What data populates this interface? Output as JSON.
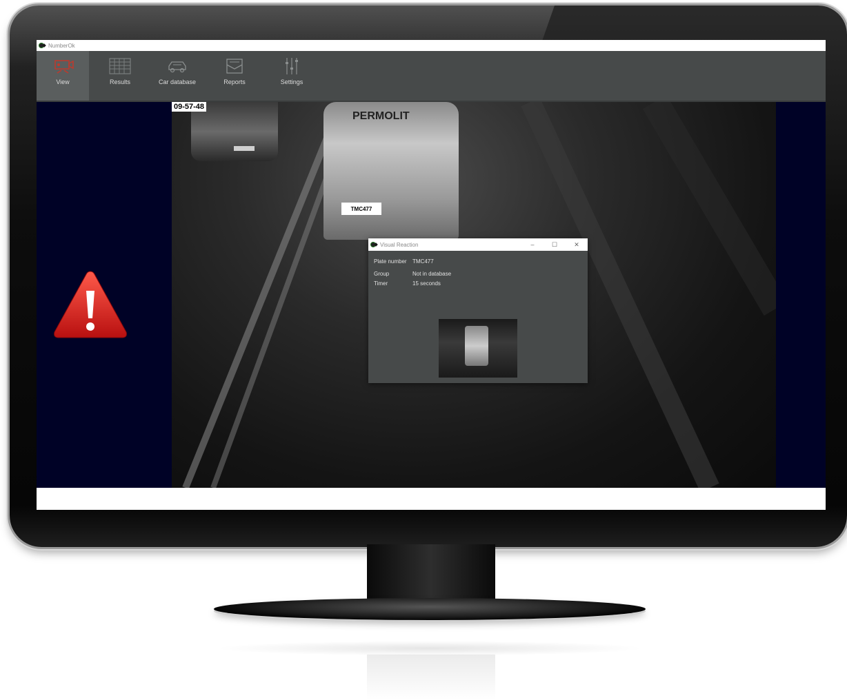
{
  "window": {
    "title": "NumberOk"
  },
  "toolbar": {
    "items": [
      {
        "label": "View",
        "icon": "camera-alert-icon",
        "active": true
      },
      {
        "label": "Results",
        "icon": "results-grid-icon",
        "active": false
      },
      {
        "label": "Car database",
        "icon": "car-icon",
        "active": false
      },
      {
        "label": "Reports",
        "icon": "envelope-report-icon",
        "active": false
      },
      {
        "label": "Settings",
        "icon": "sliders-icon",
        "active": false
      }
    ]
  },
  "camera": {
    "timestamp": "09-57-48",
    "plate_overlay": "TMC477",
    "van_brand": "PERMOLIT"
  },
  "dialog": {
    "title": "Visual Reaction",
    "plate_label": "Plate number",
    "plate_value": "TMC477",
    "group_label": "Group",
    "group_value": "Not in database",
    "timer_label": "Timer",
    "timer_value": "15 seconds",
    "minimize": "–",
    "maximize": "☐",
    "close": "✕"
  },
  "colors": {
    "toolbar_bg": "#474a4a",
    "content_bg": "#000226",
    "alert_red": "#d42020",
    "active_icon": "#c0392b"
  }
}
